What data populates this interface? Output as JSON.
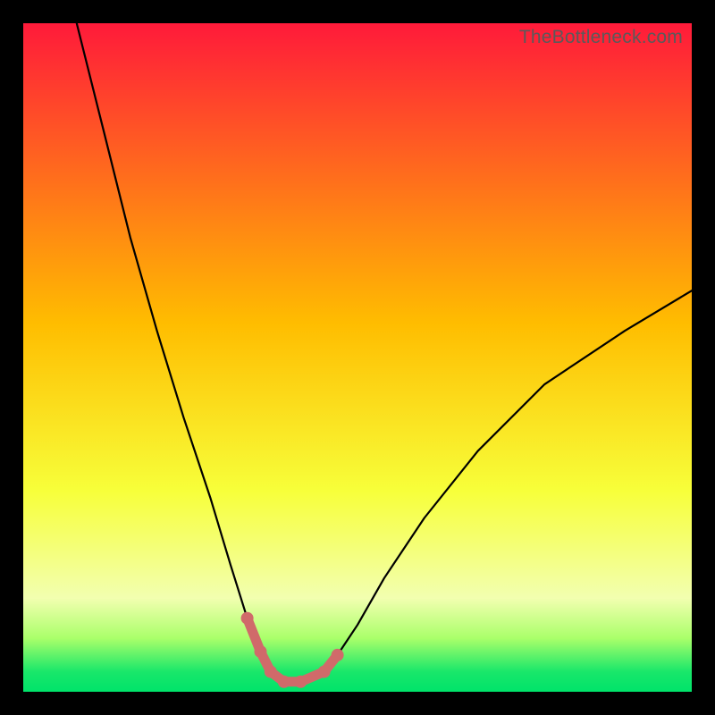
{
  "watermark": "TheBottleneck.com",
  "chart_data": {
    "type": "line",
    "title": "",
    "xlabel": "",
    "ylabel": "",
    "xlim": [
      0,
      100
    ],
    "ylim": [
      0,
      100
    ],
    "gradient_bands": [
      {
        "y": 100,
        "color": "#ff1a3a"
      },
      {
        "y": 55,
        "color": "#ffbd00"
      },
      {
        "y": 30,
        "color": "#f7ff3a"
      },
      {
        "y": 14,
        "color": "#f2ffb0"
      },
      {
        "y": 8,
        "color": "#aaff6a"
      },
      {
        "y": 3,
        "color": "#19e76a"
      },
      {
        "y": 0,
        "color": "#00e36a"
      }
    ],
    "series": [
      {
        "name": "bottleneck-curve",
        "x": [
          8,
          12,
          16,
          20,
          24,
          28,
          31,
          33.5,
          35.5,
          37,
          39,
          41.5,
          45,
          47,
          50,
          54,
          60,
          68,
          78,
          90,
          100
        ],
        "y": [
          100,
          84,
          68,
          54,
          41,
          29,
          19,
          11,
          6,
          3,
          1.5,
          1.5,
          3,
          5.5,
          10,
          17,
          26,
          36,
          46,
          54,
          60
        ]
      },
      {
        "name": "highlight-segment",
        "x": [
          33.5,
          35.5,
          37,
          39,
          41.5,
          45,
          47
        ],
        "y": [
          11,
          6,
          3,
          1.5,
          1.5,
          3,
          5.5
        ]
      }
    ],
    "highlight_dots": {
      "x": [
        33.5,
        35.5,
        37,
        39,
        41.5,
        45,
        47
      ],
      "y": [
        11,
        6,
        3,
        1.5,
        1.5,
        3,
        5.5
      ]
    }
  }
}
